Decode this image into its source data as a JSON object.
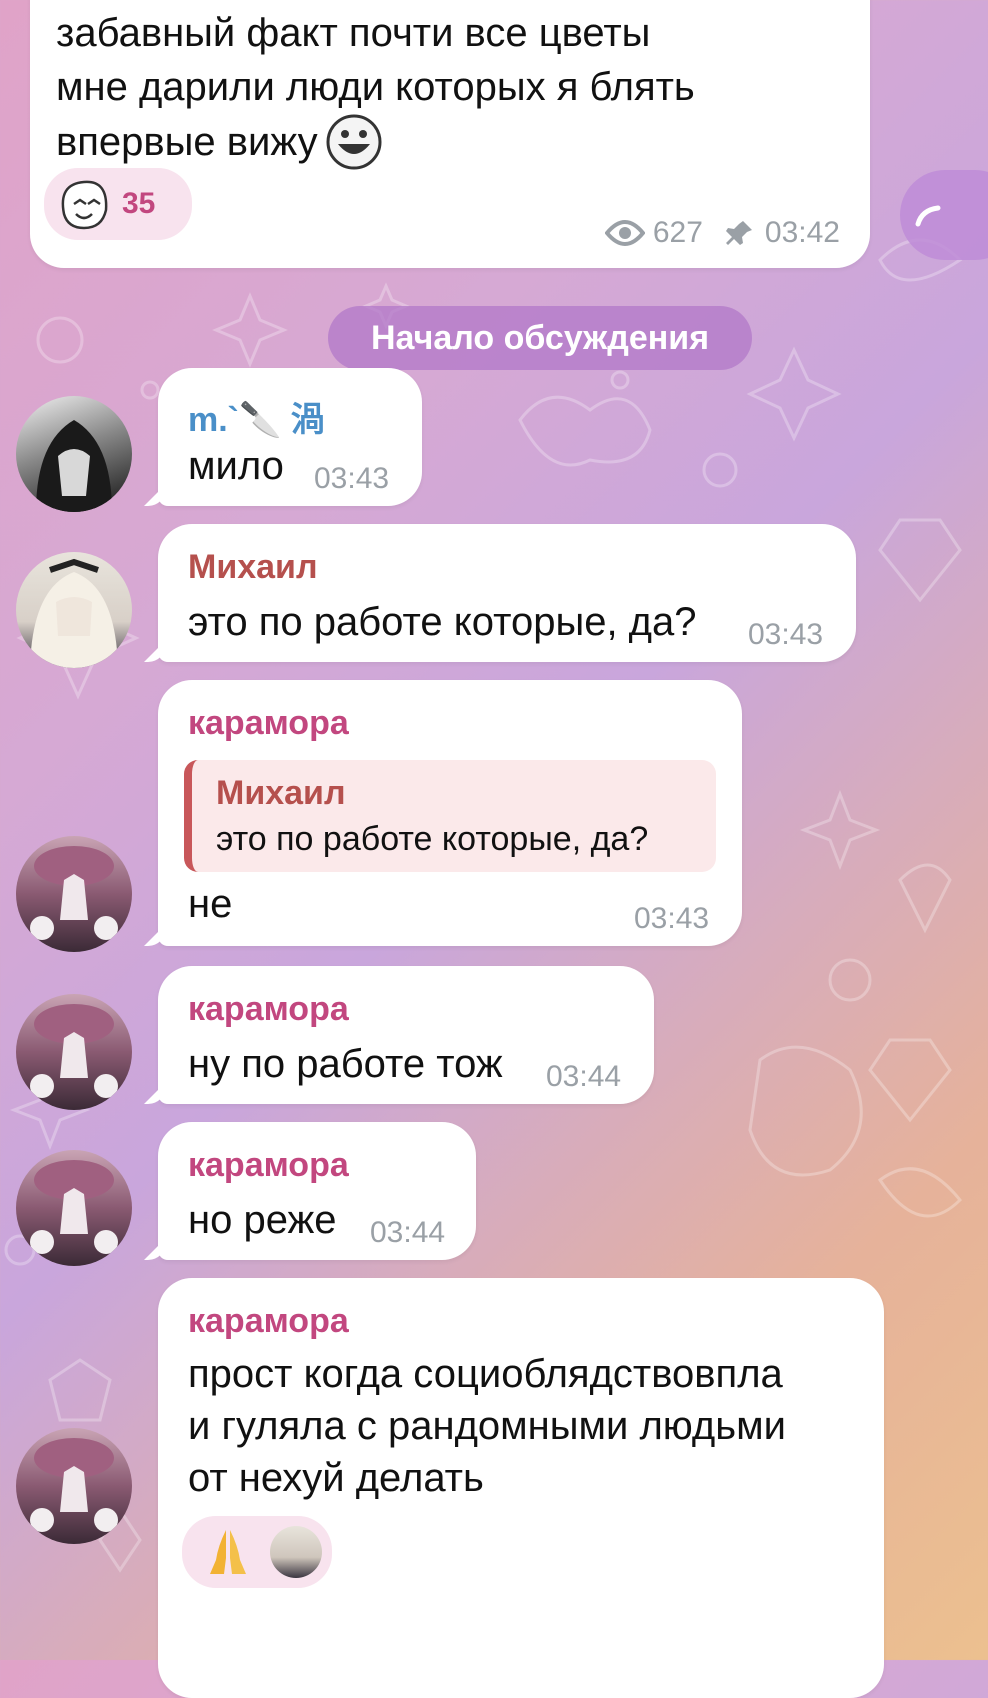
{
  "post": {
    "lines": [
      "забавный факт почти все цветы",
      "мне дарили люди которых я блять",
      "впервые вижу"
    ],
    "reaction_count": "35",
    "views": "627",
    "time": "03:42"
  },
  "divider_label": "Начало обсуждения",
  "messages": [
    {
      "author": "m.`🔪 渦",
      "text": "мило",
      "time": "03:43"
    },
    {
      "author": "Михаил",
      "text": "это по работе которые, да?",
      "time": "03:43"
    },
    {
      "author": "карамора",
      "reply_author": "Михаил",
      "reply_text": "это по работе которые, да?",
      "text": "не",
      "time": "03:43"
    },
    {
      "author": "карамора",
      "text": "ну по работе тож",
      "time": "03:44"
    },
    {
      "author": "карамора",
      "text": "но реже",
      "time": "03:44"
    },
    {
      "author": "карамора",
      "lines": [
        "прост когда социоблядствовпла",
        "и гуляла с рандомными людьми",
        "от нехуй делать"
      ]
    }
  ],
  "colors": {
    "author_m": "#4a8fc8",
    "author_mikhail": "#b5504d",
    "author_karamora": "#c2477f",
    "meta": "#9aa0a6"
  },
  "icons": {
    "eye": "eye-icon",
    "pin": "pin-icon",
    "emoji_troll": "troll-face-emoji",
    "reaction_troll": "troll-face-reaction-icon",
    "reaction_pray": "praying-hands-reaction-icon"
  }
}
